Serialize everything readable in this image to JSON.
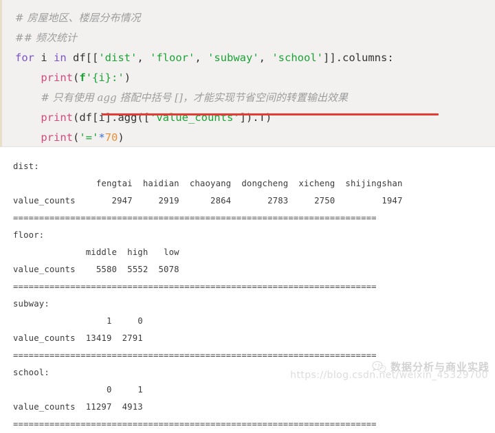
{
  "code": {
    "language": "python",
    "lines": [
      {
        "id": "line-comment-1",
        "tokens": [
          {
            "cls": "cmt",
            "t": "# 房屋地区、楼层分布情况"
          }
        ]
      },
      {
        "id": "line-comment-2",
        "tokens": [
          {
            "cls": "cmt",
            "t": "## 频次统计"
          }
        ]
      },
      {
        "id": "line-for",
        "tokens": [
          {
            "cls": "kw",
            "t": "for"
          },
          {
            "cls": "plain",
            "t": " i "
          },
          {
            "cls": "kw",
            "t": "in"
          },
          {
            "cls": "plain",
            "t": " df[["
          },
          {
            "cls": "str",
            "t": "'dist'"
          },
          {
            "cls": "plain",
            "t": ", "
          },
          {
            "cls": "str",
            "t": "'floor'"
          },
          {
            "cls": "plain",
            "t": ", "
          },
          {
            "cls": "str",
            "t": "'subway'"
          },
          {
            "cls": "plain",
            "t": ", "
          },
          {
            "cls": "str",
            "t": "'school'"
          },
          {
            "cls": "plain",
            "t": "]].columns:"
          }
        ]
      },
      {
        "id": "line-print-key",
        "tokens": [
          {
            "cls": "plain",
            "t": "    "
          },
          {
            "cls": "fn",
            "t": "print"
          },
          {
            "cls": "plain",
            "t": "("
          },
          {
            "cls": "fpre",
            "t": "f"
          },
          {
            "cls": "str",
            "t": "'{i}:'"
          },
          {
            "cls": "plain",
            "t": ")"
          }
        ]
      },
      {
        "id": "line-comment-agg",
        "tokens": [
          {
            "cls": "plain",
            "t": "    "
          },
          {
            "cls": "cmt",
            "t": "# 只有使用 agg 搭配中括号 []，才能实现节省空间的转置输出效果"
          }
        ]
      },
      {
        "id": "line-print-agg",
        "tokens": [
          {
            "cls": "plain",
            "t": "    "
          },
          {
            "cls": "fn",
            "t": "print"
          },
          {
            "cls": "plain",
            "t": "(df[i].agg(["
          },
          {
            "cls": "str",
            "t": "'value_counts'"
          },
          {
            "cls": "plain",
            "t": "]).T)"
          }
        ]
      },
      {
        "id": "line-print-sep",
        "tokens": [
          {
            "cls": "plain",
            "t": "    "
          },
          {
            "cls": "fn",
            "t": "print"
          },
          {
            "cls": "plain",
            "t": "("
          },
          {
            "cls": "str",
            "t": "'='"
          },
          {
            "cls": "op",
            "t": "*"
          },
          {
            "cls": "num",
            "t": "70"
          },
          {
            "cls": "plain",
            "t": ")"
          }
        ]
      }
    ],
    "annotation": {
      "type": "underline",
      "color": "#e23b33",
      "target_text": "agg 搭配中括号 []，才能实现节省空间的转置输出效果"
    }
  },
  "output": {
    "separator_char": "=",
    "separator_count": 70,
    "separator_line": "======================================================================",
    "index_label": "value_counts",
    "sections": [
      {
        "name": "dist",
        "header_line": "                fengtai  haidian  chaoyang  dongcheng  xicheng  shijingshan",
        "values_line": "value_counts       2947     2919      2864       2783     2750         1947",
        "columns": [
          "fengtai",
          "haidian",
          "chaoyang",
          "dongcheng",
          "xicheng",
          "shijingshan"
        ],
        "values": [
          2947,
          2919,
          2864,
          2783,
          2750,
          1947
        ]
      },
      {
        "name": "floor",
        "header_line": "              middle  high   low",
        "values_line": "value_counts    5580  5552  5078",
        "columns": [
          "middle",
          "high",
          "low"
        ],
        "values": [
          5580,
          5552,
          5078
        ]
      },
      {
        "name": "subway",
        "header_line": "                  1     0",
        "values_line": "value_counts  13419  2791",
        "columns": [
          "1",
          "0"
        ],
        "values": [
          13419,
          2791
        ]
      },
      {
        "name": "school",
        "header_line": "                  0     1",
        "values_line": "value_counts  11297  4913",
        "columns": [
          "0",
          "1"
        ],
        "values": [
          11297,
          4913
        ]
      }
    ]
  },
  "watermark": {
    "brand": "数据分析与商业实践",
    "url": "https://blog.csdn.net/weixin_45329700",
    "logo": "wechat-icon"
  },
  "colors": {
    "code_background": "#f2f1f0",
    "output_background": "#ffffff",
    "comment": "#9d9d9d",
    "keyword": "#7b52c4",
    "function": "#d44a7e",
    "string": "#1aa334",
    "number": "#e8913a",
    "operator": "#3a6fd8",
    "plain": "#333333",
    "underline": "#e23b33"
  }
}
